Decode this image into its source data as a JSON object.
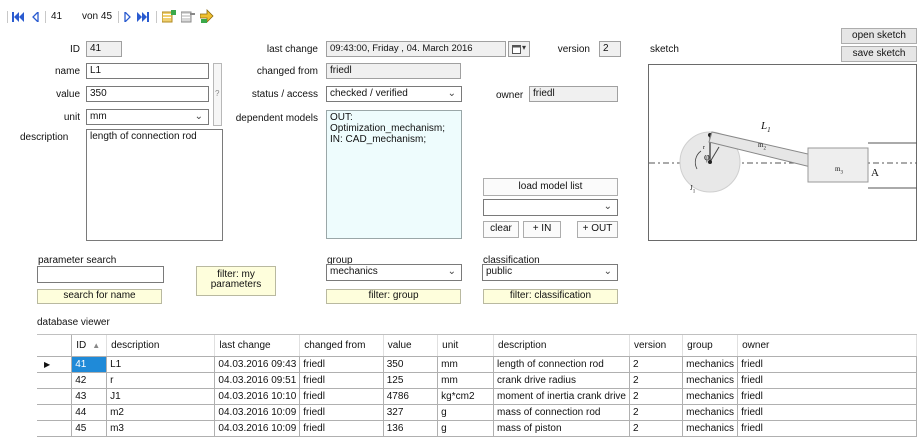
{
  "navigator": {
    "first_icon": "first-record",
    "prev_icon": "previous-record",
    "current": "41",
    "of_label": "von 45",
    "next_icon": "next-record",
    "last_icon": "last-record",
    "add_icon": "add-record",
    "delete_icon": "delete-record",
    "save_icon": "save-record"
  },
  "form": {
    "id_label": "ID",
    "id_value": "41",
    "name_label": "name",
    "name_value": "L1",
    "value_label": "value",
    "value_value": "350",
    "unit_label": "unit",
    "unit_value": "mm",
    "description_label": "description",
    "description_value": "length of connection rod",
    "question": "?",
    "last_change_label": "last change",
    "last_change_value": "09:43:00,  Friday    , 04.  March   2016",
    "changed_from_label": "changed from",
    "changed_from_value": "friedl",
    "status_label": "status / access",
    "status_value": "checked / verified",
    "dependent_label": "dependent models",
    "dependent_value": "OUT: Optimization_mechanism;\nIN: CAD_mechanism;",
    "version_label": "version",
    "version_value": "2",
    "owner_label": "owner",
    "owner_value": "friedl",
    "sketch_label": "sketch"
  },
  "buttons": {
    "open_sketch": "open sketch",
    "save_sketch": "save sketch",
    "load_model_list": "load model list",
    "clear": "clear",
    "plus_in": "+ IN",
    "plus_out": "+ OUT",
    "filter_my": "filter: my\nparameters",
    "search_name": "search for name",
    "filter_group": "filter: group",
    "filter_class": "filter: classification"
  },
  "search": {
    "label": "parameter search",
    "value": ""
  },
  "group": {
    "label": "group",
    "value": "mechanics"
  },
  "classification": {
    "label": "classification",
    "value": "public"
  },
  "viewer": {
    "label": "database viewer",
    "columns": [
      "ID",
      "description",
      "last change",
      "changed from",
      "value",
      "unit",
      "description",
      "version",
      "group",
      "owner"
    ],
    "rows": [
      [
        "41",
        "L1",
        "04.03.2016 09:43",
        "friedl",
        "350",
        "mm",
        "length of connection rod",
        "2",
        "mechanics",
        "friedl"
      ],
      [
        "42",
        "r",
        "04.03.2016 09:51",
        "friedl",
        "125",
        "mm",
        "crank drive radius",
        "2",
        "mechanics",
        "friedl"
      ],
      [
        "43",
        "J1",
        "04.03.2016 10:10",
        "friedl",
        "4786",
        "kg*cm2",
        "moment of inertia crank drive",
        "2",
        "mechanics",
        "friedl"
      ],
      [
        "44",
        "m2",
        "04.03.2016 10:09",
        "friedl",
        "327",
        "g",
        "mass of connection rod",
        "2",
        "mechanics",
        "friedl"
      ],
      [
        "45",
        "m3",
        "04.03.2016 10:09",
        "friedl",
        "136",
        "g",
        "mass of piston",
        "2",
        "mechanics",
        "friedl"
      ]
    ]
  },
  "sketch_text": {
    "L1": "L",
    "L1_sub": "1",
    "m2": "m",
    "m2_sub": "2",
    "m3": "m",
    "m3_sub": "3",
    "A": "A",
    "r": "r",
    "phi": "φ",
    "J1": "J",
    "J1_sub": "1"
  },
  "colors": {
    "selected_cell": "#1f8ad8",
    "yellow_button": "#fefedc",
    "cyan_list": "#eefcfd"
  }
}
